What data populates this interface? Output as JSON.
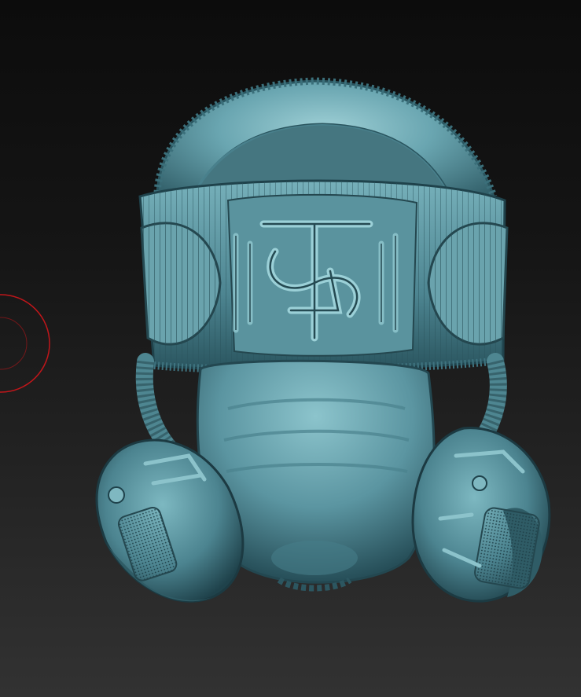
{
  "canvas": {
    "background_top": "#0c0c0c",
    "background_bottom": "#323232"
  },
  "model": {
    "material_color": "#5f97a3",
    "highlight_color": "#9fd0d6",
    "shadow_color": "#1c3a42"
  },
  "brush_cursor": {
    "icon": "brush-circle-icon",
    "color": "#c0161a"
  }
}
